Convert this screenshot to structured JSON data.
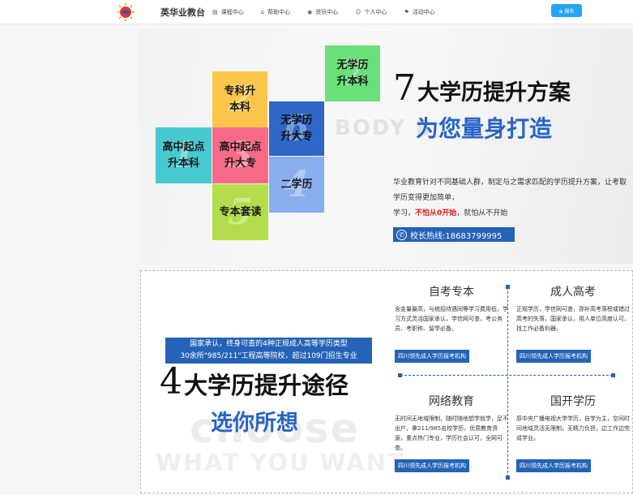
{
  "header": {
    "brand": "英华业教台",
    "nav": [
      {
        "label": "课程中心",
        "icon": "book-icon"
      },
      {
        "label": "帮助中心",
        "icon": "home-icon"
      },
      {
        "label": "资讯中心",
        "icon": "news-icon"
      },
      {
        "label": "个人中心",
        "icon": "user-icon"
      },
      {
        "label": "活动中心",
        "icon": "flag-icon"
      }
    ],
    "signup_label": "⊕ 报名"
  },
  "hero": {
    "tiles": {
      "none2bach": "无学历\n升本科",
      "zhuan2bach": "专科升\n本科",
      "none2zhuan": "无学历\n升大专",
      "hs2bach": "高中起点\n升本科",
      "hs2zhuan": "高中起点\n升大专",
      "second": "二学历",
      "package": "专本套读"
    },
    "ghost_nums": {
      "none2bach": "7",
      "zhuan2bach": "2",
      "none2zhuan": "6",
      "hs2bach": "1",
      "hs2zhuan": "3",
      "second": "4",
      "package": "5"
    },
    "bg_text": "BODY B",
    "num": "7",
    "title1": "大学历提升方案",
    "title2": "为您量身打造",
    "desc_line1": "华业教育针对不同基础人群，制定与之需求匹配的学历提升方案，让考取学历变得更加简单，",
    "desc_prefix": "学习，",
    "desc_red": "不怕从0开始",
    "desc_suffix": "，就怕从不开始",
    "hotline": "校长热线:18683799995"
  },
  "section2": {
    "banner_line1": "国家承认，终身可查的4种正规成人高等学历类型",
    "banner_line2": "30余所\"985/211\"工程高等院校，超过109门招生专业",
    "num": "4",
    "title": "大学历提升途径",
    "subtitle": "选你所想",
    "bg_word": "choose",
    "bg_phrase": "WHAT YOU WANT",
    "cards": [
      {
        "title": "自考专本",
        "desc": "含金量最高，与统招待遇同等学习费用低，学习方式灵活国家承认，学信网可查，考公务员、考职称、留学必备。",
        "button": "四川领先成人学历报考机构"
      },
      {
        "title": "成人高考",
        "desc": "正规学历，学信网可查，弥补高考落榜或错过高考的失落，国家承认，用人单位高度认可，找工作必备利器。",
        "button": "四川领先成人学历报考机构"
      },
      {
        "title": "网络教育",
        "desc": "无时间无地域限制，随时随地想学就学，足不出户，拿211/985名校学历，优质教育资源，重点热门专业，学历社会认可，全网可查。",
        "button": "四川领先成人学历报考机构"
      },
      {
        "title": "国开学历",
        "desc": "原中央广播电视大学学历，自学为主，空间时间地域灵活无限制，无精力负担，边工作边完成学业。",
        "button": "四川领先成人学历报考机构"
      }
    ]
  }
}
